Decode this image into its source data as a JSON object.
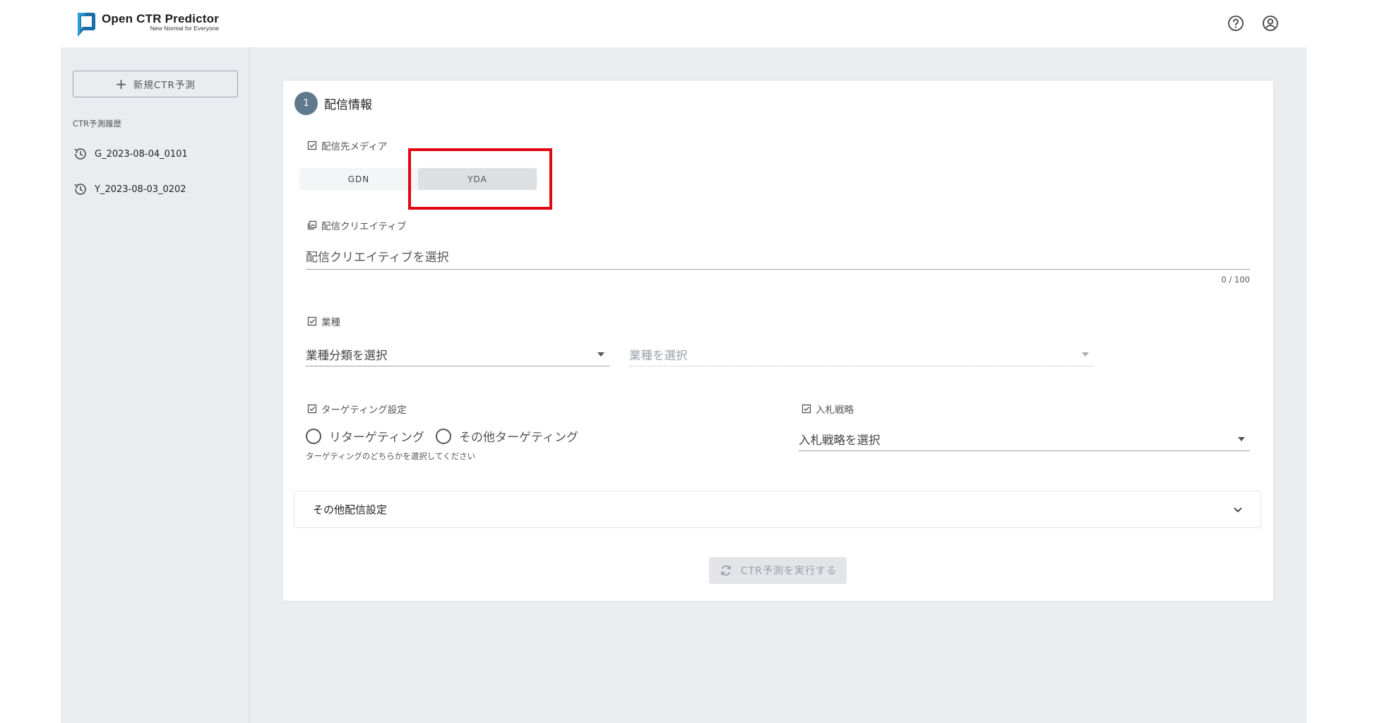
{
  "header": {
    "app_title": "Open CTR Predictor",
    "app_subtitle": "New Normal for Everyone",
    "help_icon": "help-circle-icon",
    "account_icon": "account-circle-icon"
  },
  "sidebar": {
    "new_button_label": "新規CTR予測",
    "history_title": "CTR予測履歴",
    "history_items": [
      {
        "label": "G_2023-08-04_0101",
        "icon": "history-icon"
      },
      {
        "label": "Y_2023-08-03_0202",
        "icon": "history-icon"
      }
    ]
  },
  "form": {
    "step_number": "1",
    "step_title": "配信情報",
    "media": {
      "label": "配信先メディア",
      "options": [
        "GDN",
        "YDA"
      ],
      "selected": "YDA"
    },
    "creative": {
      "label": "配信クリエイティブ",
      "placeholder": "配信クリエイティブを選択",
      "value": "",
      "counter": "0 / 100"
    },
    "industry": {
      "label": "業種",
      "category_placeholder": "業種分類を選択",
      "industry_placeholder": "業種を選択"
    },
    "targeting": {
      "label": "ターゲティング設定",
      "options": [
        "リターゲティング",
        "その他ターゲティング"
      ],
      "helper": "ターゲティングのどちらかを選択してください"
    },
    "bidding": {
      "label": "入札戦略",
      "placeholder": "入札戦略を選択"
    },
    "other_settings_label": "その他配信設定",
    "run_button_label": "CTR予測を実行する"
  },
  "colors": {
    "frame_bg": "#eaedf0",
    "step_circle": "#5f7a8c",
    "highlight": "#e10612"
  }
}
